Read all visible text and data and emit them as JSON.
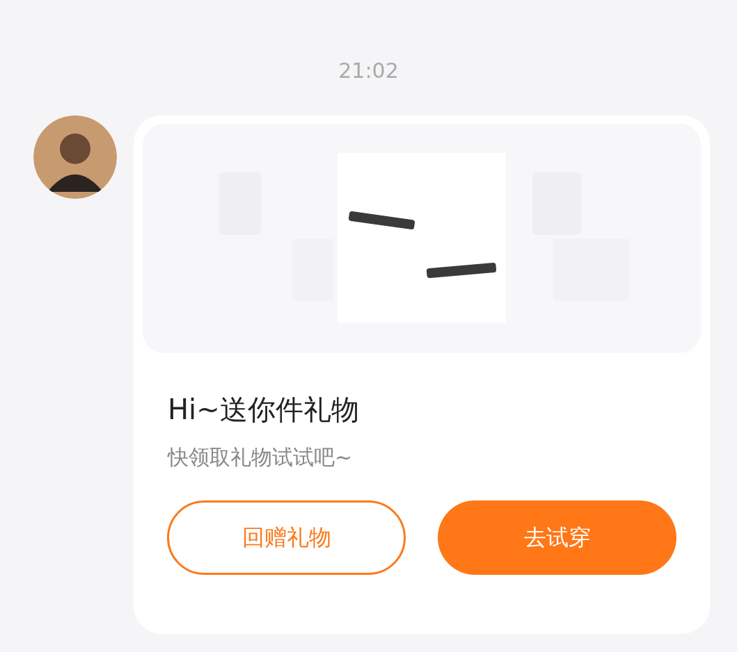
{
  "timestamp": "21:02",
  "message": {
    "title": "Hi~送你件礼物",
    "subtitle": "快领取礼物试试吧~",
    "buttons": [
      {
        "label": "回赠礼物",
        "kind": "outline"
      },
      {
        "label": "去试穿",
        "kind": "filled"
      }
    ]
  }
}
